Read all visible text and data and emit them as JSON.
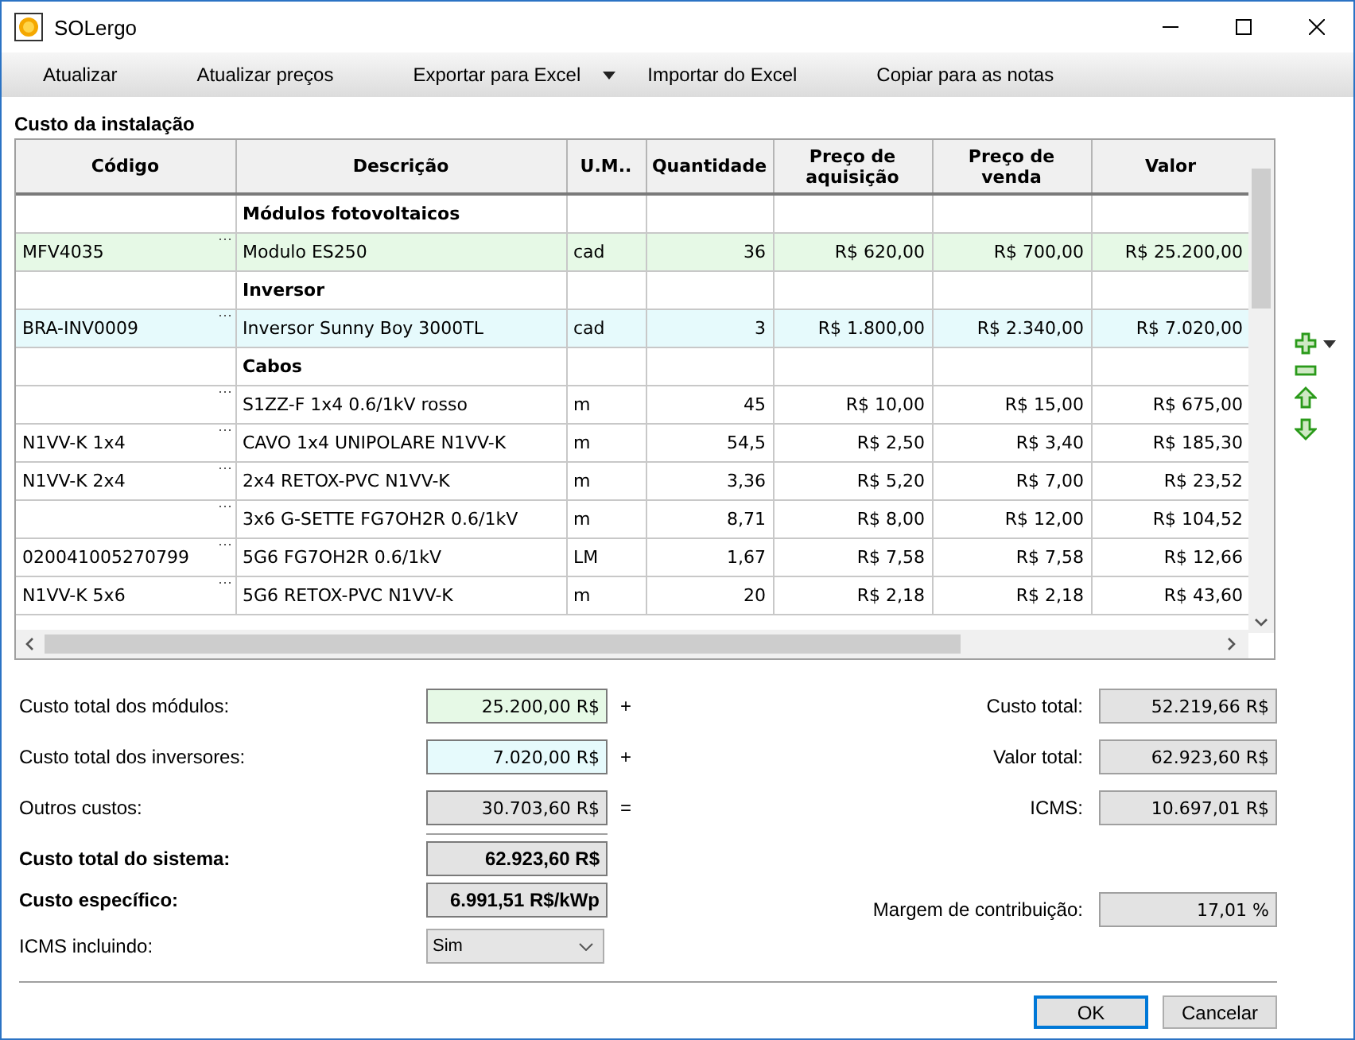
{
  "window": {
    "title": "SOLergo"
  },
  "toolbar": [
    {
      "label": "Atualizar",
      "has_menu": false
    },
    {
      "label": "Atualizar preços",
      "has_menu": false
    },
    {
      "label": "Exportar para Excel",
      "has_menu": true
    },
    {
      "label": "Importar do Excel",
      "has_menu": false
    },
    {
      "label": "Copiar para as notas",
      "has_menu": false
    }
  ],
  "section_title": "Custo da instalação",
  "table": {
    "columns": [
      "Código",
      "Descrição",
      "U.M..",
      "Quantidade",
      "Preço de aquisição",
      "Preço de venda",
      "Valor"
    ],
    "rows": [
      {
        "kind": "group",
        "label": "Módulos fotovoltaicos"
      },
      {
        "kind": "item",
        "color": "#e6f9e6",
        "cells": [
          "MFV4035",
          "Modulo ES250",
          "cad",
          "36",
          "R$ 620,00",
          "R$ 700,00",
          "R$ 25.200,00"
        ]
      },
      {
        "kind": "group",
        "label": "Inversor"
      },
      {
        "kind": "item",
        "color": "#e6fafc",
        "cells": [
          "BRA-INV0009",
          "Inversor Sunny Boy 3000TL",
          "cad",
          "3",
          "R$ 1.800,00",
          "R$ 2.340,00",
          "R$ 7.020,00"
        ]
      },
      {
        "kind": "group",
        "label": "Cabos"
      },
      {
        "kind": "item",
        "cells": [
          "",
          "S1ZZ-F 1x4 0.6/1kV rosso",
          "m",
          "45",
          "R$ 10,00",
          "R$ 15,00",
          "R$ 675,00"
        ]
      },
      {
        "kind": "item",
        "cells": [
          "N1VV-K 1x4",
          "CAVO 1x4   UNIPOLARE N1VV-K",
          "m",
          "54,5",
          "R$ 2,50",
          "R$ 3,40",
          "R$ 185,30"
        ]
      },
      {
        "kind": "item",
        "cells": [
          "N1VV-K 2x4",
          "2x4 RETOX-PVC N1VV-K",
          "m",
          "3,36",
          "R$ 5,20",
          "R$ 7,00",
          "R$ 23,52"
        ]
      },
      {
        "kind": "item",
        "cells": [
          "",
          "3x6 G-SETTE FG7OH2R 0.6/1kV",
          "m",
          "8,71",
          "R$ 8,00",
          "R$ 12,00",
          "R$ 104,52"
        ]
      },
      {
        "kind": "item",
        "cells": [
          "020041005270799",
          "5G6 FG7OH2R 0.6/1kV",
          "LM",
          "1,67",
          "R$ 7,58",
          "R$ 7,58",
          "R$ 12,66"
        ]
      },
      {
        "kind": "item",
        "cells": [
          "N1VV-K 5x6",
          "5G6 RETOX-PVC N1VV-K",
          "m",
          "20",
          "R$ 2,18",
          "R$ 2,18",
          "R$ 43,60"
        ]
      }
    ]
  },
  "summary_left": [
    {
      "label": "Custo total dos módulos:",
      "value": "25.200,00 R$",
      "operator": "+",
      "bold": false,
      "color": "#e6f9e6"
    },
    {
      "label": "Custo total dos inversores:",
      "value": "7.020,00 R$",
      "operator": "+",
      "bold": false,
      "color": "#e6fafc"
    },
    {
      "label": "Outros custos:",
      "value": "30.703,60 R$",
      "operator": "=",
      "bold": false,
      "color": "#e3e3e3"
    },
    {
      "label": "Custo total do sistema:",
      "value": "62.923,60 R$",
      "bold": true,
      "color": "#e3e3e3"
    },
    {
      "label": "Custo específico:",
      "value": "6.991,51 R$/kWp",
      "bold": true,
      "color": "#e3e3e3"
    }
  ],
  "icms_included": {
    "label": "ICMS incluindo:",
    "value": "Sim"
  },
  "summary_right": [
    {
      "label": "Custo total:",
      "value": "52.219,66 R$"
    },
    {
      "label": "Valor total:",
      "value": "62.923,60 R$"
    },
    {
      "label": "ICMS:",
      "value": "10.697,01 R$"
    }
  ],
  "margin": {
    "label": "Margem de contribuição:",
    "value": "17,01 %"
  },
  "buttons": [
    {
      "label": "OK",
      "default": true
    },
    {
      "label": "Cancelar",
      "default": false
    }
  ]
}
